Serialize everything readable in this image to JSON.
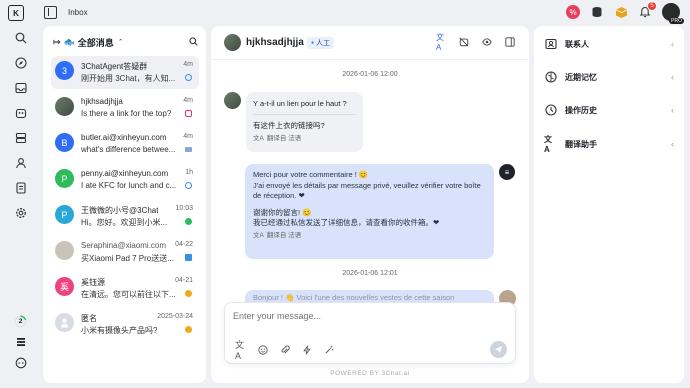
{
  "topbar": {
    "logo_glyph": "K",
    "title": "Inbox",
    "notification_count": "5",
    "user_badge": "PRO"
  },
  "nav": {
    "progress_badge": "2"
  },
  "list": {
    "header_title": "全部消息",
    "conversations": [
      {
        "avatar": "3",
        "avatar_color": "#2f6df6",
        "name": "3ChatAgent答疑群",
        "time": "4m",
        "preview": "刚开始用 3Chat，有人知...",
        "channel_color": "#3a8ee6",
        "active": true
      },
      {
        "avatar": "",
        "avatar_color": "#4a5a4a",
        "name": "hjkhsadjhjja",
        "time": "4m",
        "preview": "Is there a link for the top?",
        "channel_color": "#e1306c"
      },
      {
        "avatar": "B",
        "avatar_color": "#2f6df6",
        "name": "butler.ai@xinheyun.com",
        "time": "4m",
        "preview": "what's difference betwee...",
        "channel_color": "#8aa4d6"
      },
      {
        "avatar": "P",
        "avatar_color": "#2dbb5c",
        "name": "penny.ai@xinheyun.com",
        "time": "1h",
        "preview": "I ate KFC for lunch and c...",
        "channel_color": "#3a8ee6"
      },
      {
        "avatar": "P",
        "avatar_color": "#2aa7d6",
        "name": "王微微的小号@3Chat",
        "time": "10:03",
        "preview": "Hi。您好。欢迎到小米...",
        "channel_color": "#2dbb5c"
      },
      {
        "avatar": "",
        "avatar_color": "#c9c3b8",
        "name": "Seraphina@xiaomi.com",
        "time": "04-22",
        "preview": "买Xiaomi Pad 7 Pro送送...",
        "channel_color": "#3a8ee6"
      },
      {
        "avatar": "奚",
        "avatar_color": "#f0437e",
        "name": "奚钰源",
        "time": "04-21",
        "preview": "在清远。您可以前往以下...",
        "channel_color": "#f2a81d"
      },
      {
        "avatar": "",
        "avatar_color": "#d9dce2",
        "name": "匿名",
        "time": "2025-03-24",
        "preview": "小米有摄像头产品吗?",
        "channel_color": "#f2a81d"
      }
    ]
  },
  "chat": {
    "name": "hjkhsadjhjja",
    "role_tag": "人工",
    "date1": "2026-01-06  12:00",
    "incoming": {
      "original": "Y a-t-il un lien pour le haut ?",
      "translated": "有这件上衣的链接吗?",
      "translate_note": "翻译自 法语"
    },
    "outgoing": {
      "line1": "Merci pour votre commentaire ! 😊",
      "line2": "J'ai envoyé les détails par message privé, veuillez vérifier votre boîte de réception. ❤",
      "translated1": "谢谢你的留言! 😊",
      "translated2": "我已经通过私信发送了详细信息，请查看你的收件箱。❤",
      "translate_note": "翻译自 法语"
    },
    "date2": "2026-01-06  12:01",
    "partial_text": "Bonjour ! 👋 Voici l'une des nouvelles vestes de cette saison",
    "composer_placeholder": "Enter your message...",
    "powered_by": "POWERED BY  3Chat.ai"
  },
  "right_panel": {
    "items": [
      {
        "label": "联系人"
      },
      {
        "label": "近期记忆"
      },
      {
        "label": "操作历史"
      },
      {
        "label": "翻译助手"
      }
    ]
  }
}
